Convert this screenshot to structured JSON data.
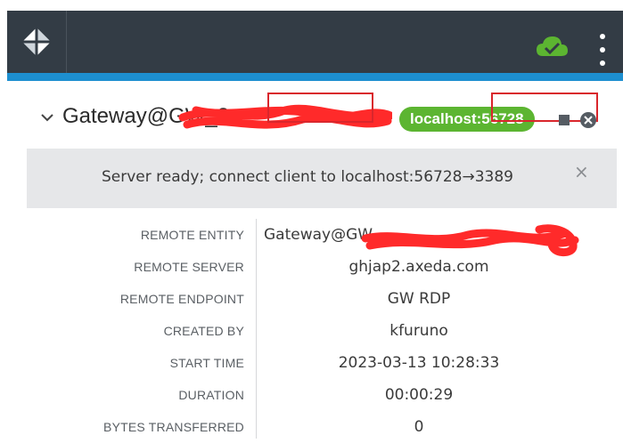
{
  "header": {
    "logo": "axeda-logo",
    "cloud_icon": "cloud-check-icon",
    "menu_icon": "kebab-menu-icon",
    "colors": {
      "bar": "#333c45",
      "accent": "#1d8fd0",
      "cloud": "#5cb531"
    }
  },
  "session": {
    "title": "Gateway@GW_3",
    "port_badge": "localhost:56728",
    "badge_color": "#5cb531"
  },
  "banner": {
    "message": "Server ready; connect client to localhost:56728→3389",
    "close": "×"
  },
  "details": {
    "rows": [
      {
        "label": "REMOTE ENTITY",
        "value": "Gateway@GW"
      },
      {
        "label": "REMOTE SERVER",
        "value": "ghjap2.axeda.com"
      },
      {
        "label": "REMOTE ENDPOINT",
        "value": "GW RDP"
      },
      {
        "label": "CREATED BY",
        "value": "kfuruno"
      },
      {
        "label": "START TIME",
        "value": "2023-03-13 10:28:33"
      },
      {
        "label": "DURATION",
        "value": "00:00:29"
      },
      {
        "label": "BYTES TRANSFERRED",
        "value": "0"
      }
    ]
  },
  "annotations": {
    "highlight_color": "#d9262c",
    "scribble_color": "#ff2a2a"
  }
}
